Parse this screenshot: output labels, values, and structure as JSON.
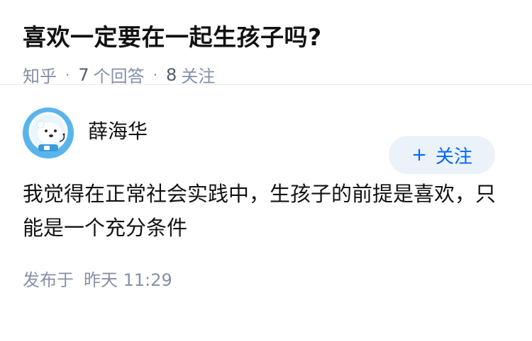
{
  "question": {
    "title": "喜欢一定要在一起生孩子吗?",
    "source": "知乎",
    "answer_count": "7",
    "answer_label": "个回答",
    "follower_count": "8",
    "follower_label": "关注"
  },
  "answer": {
    "author_name": "薛海华",
    "avatar": "polar-bear-astronaut-avatar",
    "follow_plus": "+",
    "follow_label": "关注",
    "content": "我觉得在正常社会实践中，生孩子的前提是喜欢，只能是一个充分条件",
    "published_label": "发布于",
    "published_time": "昨天 11:29"
  },
  "colors": {
    "accent": "#0066ff",
    "follow_bg": "#ebf2fa",
    "meta": "#8590a6",
    "avatar_bg": "#5ab4ec"
  }
}
